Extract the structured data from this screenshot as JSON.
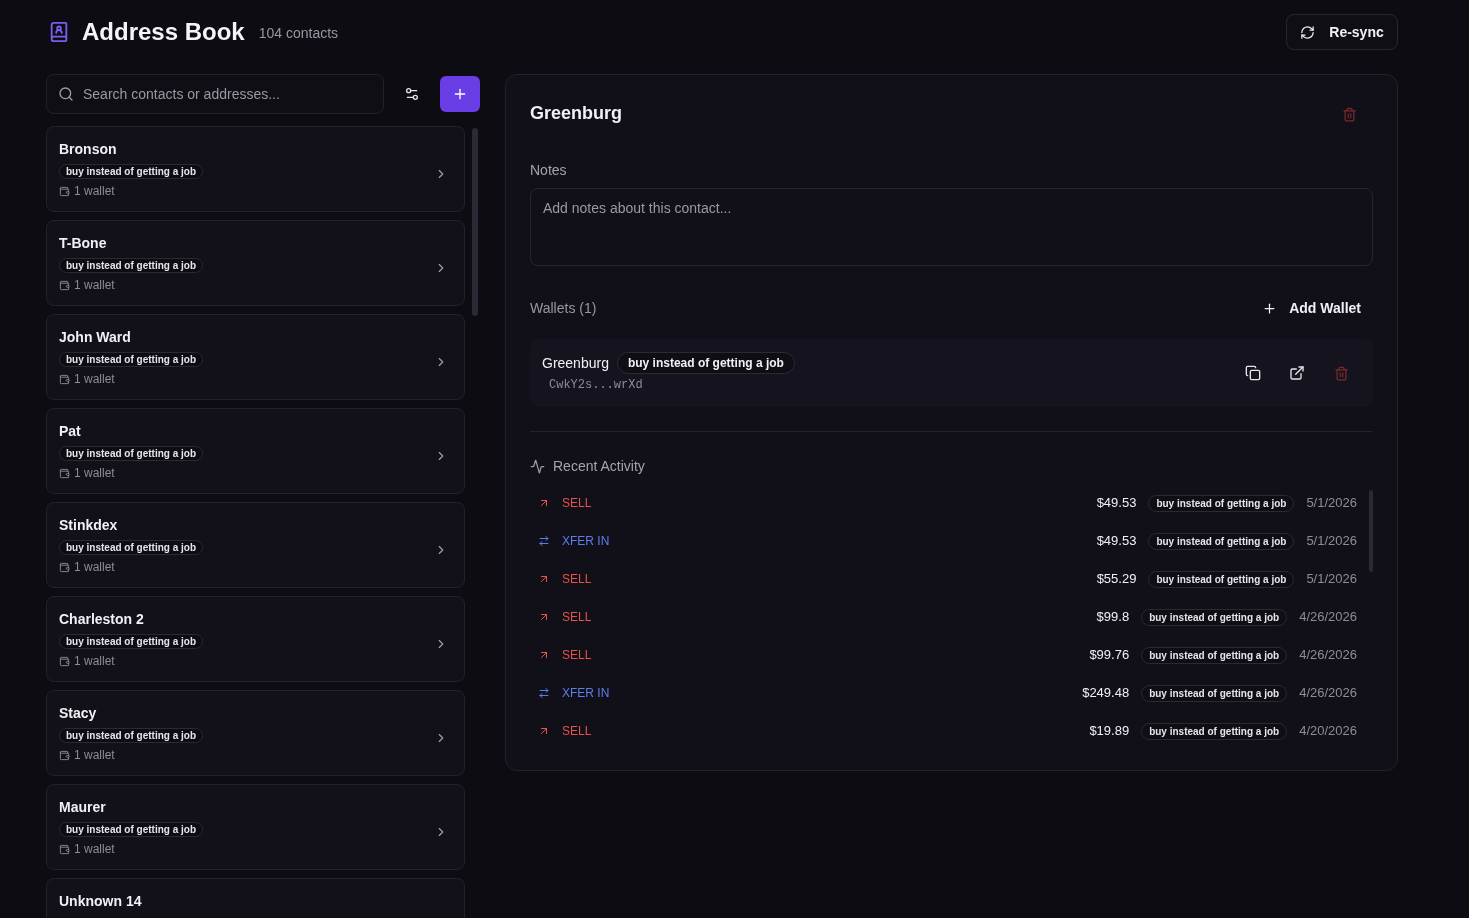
{
  "header": {
    "title": "Address Book",
    "count": "104 contacts",
    "resync": "Re-sync"
  },
  "search": {
    "placeholder": "Search contacts or addresses..."
  },
  "contacts": [
    {
      "name": "Bronson",
      "tag": "buy instead of getting a job",
      "wallets": "1 wallet"
    },
    {
      "name": "T-Bone",
      "tag": "buy instead of getting a job",
      "wallets": "1 wallet"
    },
    {
      "name": "John Ward",
      "tag": "buy instead of getting a job",
      "wallets": "1 wallet"
    },
    {
      "name": "Pat",
      "tag": "buy instead of getting a job",
      "wallets": "1 wallet"
    },
    {
      "name": "Stinkdex",
      "tag": "buy instead of getting a job",
      "wallets": "1 wallet"
    },
    {
      "name": "Charleston 2",
      "tag": "buy instead of getting a job",
      "wallets": "1 wallet"
    },
    {
      "name": "Stacy",
      "tag": "buy instead of getting a job",
      "wallets": "1 wallet"
    },
    {
      "name": "Maurer",
      "tag": "buy instead of getting a job",
      "wallets": "1 wallet"
    },
    {
      "name": "Unknown 14"
    }
  ],
  "detail": {
    "name": "Greenburg",
    "notes_label": "Notes",
    "notes_placeholder": "Add notes about this contact...",
    "wallets_heading": "Wallets (1)",
    "add_wallet": "Add Wallet",
    "wallets": [
      {
        "name": "Greenburg",
        "tag": "buy instead of getting a job",
        "address": "CwkY2s...wrXd"
      }
    ],
    "activity_heading": "Recent Activity",
    "activity": [
      {
        "kind": "sell",
        "type": "SELL",
        "amount": "$49.53",
        "tag": "buy instead of getting a job",
        "date": "5/1/2026"
      },
      {
        "kind": "transfer",
        "type": "XFER IN",
        "amount": "$49.53",
        "tag": "buy instead of getting a job",
        "date": "5/1/2026"
      },
      {
        "kind": "sell",
        "type": "SELL",
        "amount": "$55.29",
        "tag": "buy instead of getting a job",
        "date": "5/1/2026"
      },
      {
        "kind": "sell",
        "type": "SELL",
        "amount": "$99.8",
        "tag": "buy instead of getting a job",
        "date": "4/26/2026"
      },
      {
        "kind": "sell",
        "type": "SELL",
        "amount": "$99.76",
        "tag": "buy instead of getting a job",
        "date": "4/26/2026"
      },
      {
        "kind": "transfer",
        "type": "XFER IN",
        "amount": "$249.48",
        "tag": "buy instead of getting a job",
        "date": "4/26/2026"
      },
      {
        "kind": "sell",
        "type": "SELL",
        "amount": "$19.89",
        "tag": "buy instead of getting a job",
        "date": "4/20/2026"
      }
    ]
  }
}
